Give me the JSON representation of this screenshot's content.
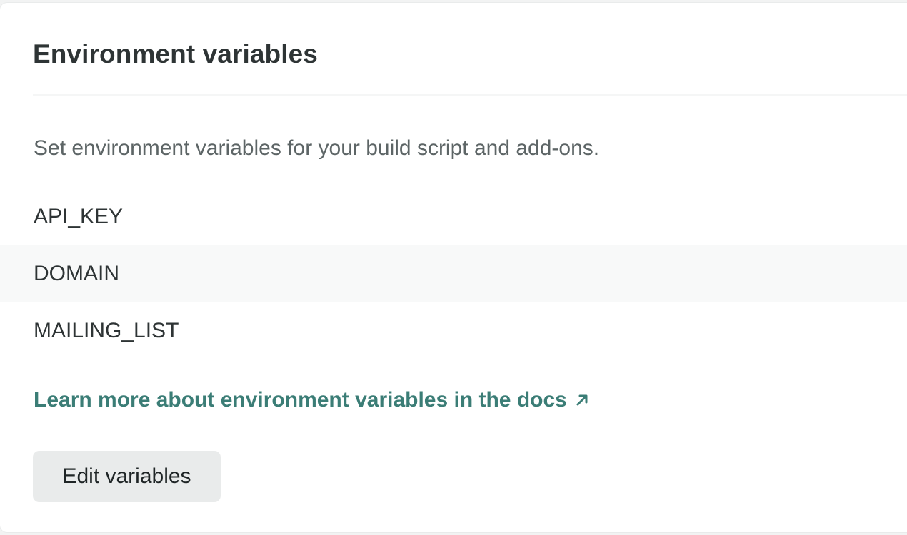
{
  "card": {
    "title": "Environment variables",
    "description": "Set environment variables for your build script and add-ons."
  },
  "variables": [
    {
      "name": "API_KEY"
    },
    {
      "name": "DOMAIN"
    },
    {
      "name": "MAILING_LIST"
    }
  ],
  "docs_link": {
    "label": "Learn more about environment variables in the docs",
    "icon": "external-arrow-icon"
  },
  "actions": {
    "edit_label": "Edit variables"
  },
  "colors": {
    "link": "#3b7d76",
    "heading": "#2e3435",
    "muted_text": "#5d6566",
    "button_bg": "#e9ebeb",
    "alt_row_bg": "#f8f9f9"
  }
}
